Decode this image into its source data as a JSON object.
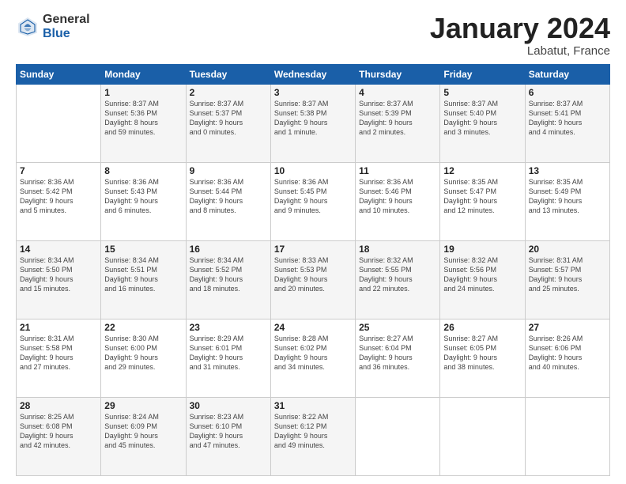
{
  "header": {
    "logo_general": "General",
    "logo_blue": "Blue",
    "month_title": "January 2024",
    "location": "Labatut, France"
  },
  "days_of_week": [
    "Sunday",
    "Monday",
    "Tuesday",
    "Wednesday",
    "Thursday",
    "Friday",
    "Saturday"
  ],
  "weeks": [
    [
      {
        "day": "",
        "info": ""
      },
      {
        "day": "1",
        "info": "Sunrise: 8:37 AM\nSunset: 5:36 PM\nDaylight: 8 hours\nand 59 minutes."
      },
      {
        "day": "2",
        "info": "Sunrise: 8:37 AM\nSunset: 5:37 PM\nDaylight: 9 hours\nand 0 minutes."
      },
      {
        "day": "3",
        "info": "Sunrise: 8:37 AM\nSunset: 5:38 PM\nDaylight: 9 hours\nand 1 minute."
      },
      {
        "day": "4",
        "info": "Sunrise: 8:37 AM\nSunset: 5:39 PM\nDaylight: 9 hours\nand 2 minutes."
      },
      {
        "day": "5",
        "info": "Sunrise: 8:37 AM\nSunset: 5:40 PM\nDaylight: 9 hours\nand 3 minutes."
      },
      {
        "day": "6",
        "info": "Sunrise: 8:37 AM\nSunset: 5:41 PM\nDaylight: 9 hours\nand 4 minutes."
      }
    ],
    [
      {
        "day": "7",
        "info": "Sunrise: 8:36 AM\nSunset: 5:42 PM\nDaylight: 9 hours\nand 5 minutes."
      },
      {
        "day": "8",
        "info": "Sunrise: 8:36 AM\nSunset: 5:43 PM\nDaylight: 9 hours\nand 6 minutes."
      },
      {
        "day": "9",
        "info": "Sunrise: 8:36 AM\nSunset: 5:44 PM\nDaylight: 9 hours\nand 8 minutes."
      },
      {
        "day": "10",
        "info": "Sunrise: 8:36 AM\nSunset: 5:45 PM\nDaylight: 9 hours\nand 9 minutes."
      },
      {
        "day": "11",
        "info": "Sunrise: 8:36 AM\nSunset: 5:46 PM\nDaylight: 9 hours\nand 10 minutes."
      },
      {
        "day": "12",
        "info": "Sunrise: 8:35 AM\nSunset: 5:47 PM\nDaylight: 9 hours\nand 12 minutes."
      },
      {
        "day": "13",
        "info": "Sunrise: 8:35 AM\nSunset: 5:49 PM\nDaylight: 9 hours\nand 13 minutes."
      }
    ],
    [
      {
        "day": "14",
        "info": "Sunrise: 8:34 AM\nSunset: 5:50 PM\nDaylight: 9 hours\nand 15 minutes."
      },
      {
        "day": "15",
        "info": "Sunrise: 8:34 AM\nSunset: 5:51 PM\nDaylight: 9 hours\nand 16 minutes."
      },
      {
        "day": "16",
        "info": "Sunrise: 8:34 AM\nSunset: 5:52 PM\nDaylight: 9 hours\nand 18 minutes."
      },
      {
        "day": "17",
        "info": "Sunrise: 8:33 AM\nSunset: 5:53 PM\nDaylight: 9 hours\nand 20 minutes."
      },
      {
        "day": "18",
        "info": "Sunrise: 8:32 AM\nSunset: 5:55 PM\nDaylight: 9 hours\nand 22 minutes."
      },
      {
        "day": "19",
        "info": "Sunrise: 8:32 AM\nSunset: 5:56 PM\nDaylight: 9 hours\nand 24 minutes."
      },
      {
        "day": "20",
        "info": "Sunrise: 8:31 AM\nSunset: 5:57 PM\nDaylight: 9 hours\nand 25 minutes."
      }
    ],
    [
      {
        "day": "21",
        "info": "Sunrise: 8:31 AM\nSunset: 5:58 PM\nDaylight: 9 hours\nand 27 minutes."
      },
      {
        "day": "22",
        "info": "Sunrise: 8:30 AM\nSunset: 6:00 PM\nDaylight: 9 hours\nand 29 minutes."
      },
      {
        "day": "23",
        "info": "Sunrise: 8:29 AM\nSunset: 6:01 PM\nDaylight: 9 hours\nand 31 minutes."
      },
      {
        "day": "24",
        "info": "Sunrise: 8:28 AM\nSunset: 6:02 PM\nDaylight: 9 hours\nand 34 minutes."
      },
      {
        "day": "25",
        "info": "Sunrise: 8:27 AM\nSunset: 6:04 PM\nDaylight: 9 hours\nand 36 minutes."
      },
      {
        "day": "26",
        "info": "Sunrise: 8:27 AM\nSunset: 6:05 PM\nDaylight: 9 hours\nand 38 minutes."
      },
      {
        "day": "27",
        "info": "Sunrise: 8:26 AM\nSunset: 6:06 PM\nDaylight: 9 hours\nand 40 minutes."
      }
    ],
    [
      {
        "day": "28",
        "info": "Sunrise: 8:25 AM\nSunset: 6:08 PM\nDaylight: 9 hours\nand 42 minutes."
      },
      {
        "day": "29",
        "info": "Sunrise: 8:24 AM\nSunset: 6:09 PM\nDaylight: 9 hours\nand 45 minutes."
      },
      {
        "day": "30",
        "info": "Sunrise: 8:23 AM\nSunset: 6:10 PM\nDaylight: 9 hours\nand 47 minutes."
      },
      {
        "day": "31",
        "info": "Sunrise: 8:22 AM\nSunset: 6:12 PM\nDaylight: 9 hours\nand 49 minutes."
      },
      {
        "day": "",
        "info": ""
      },
      {
        "day": "",
        "info": ""
      },
      {
        "day": "",
        "info": ""
      }
    ]
  ]
}
